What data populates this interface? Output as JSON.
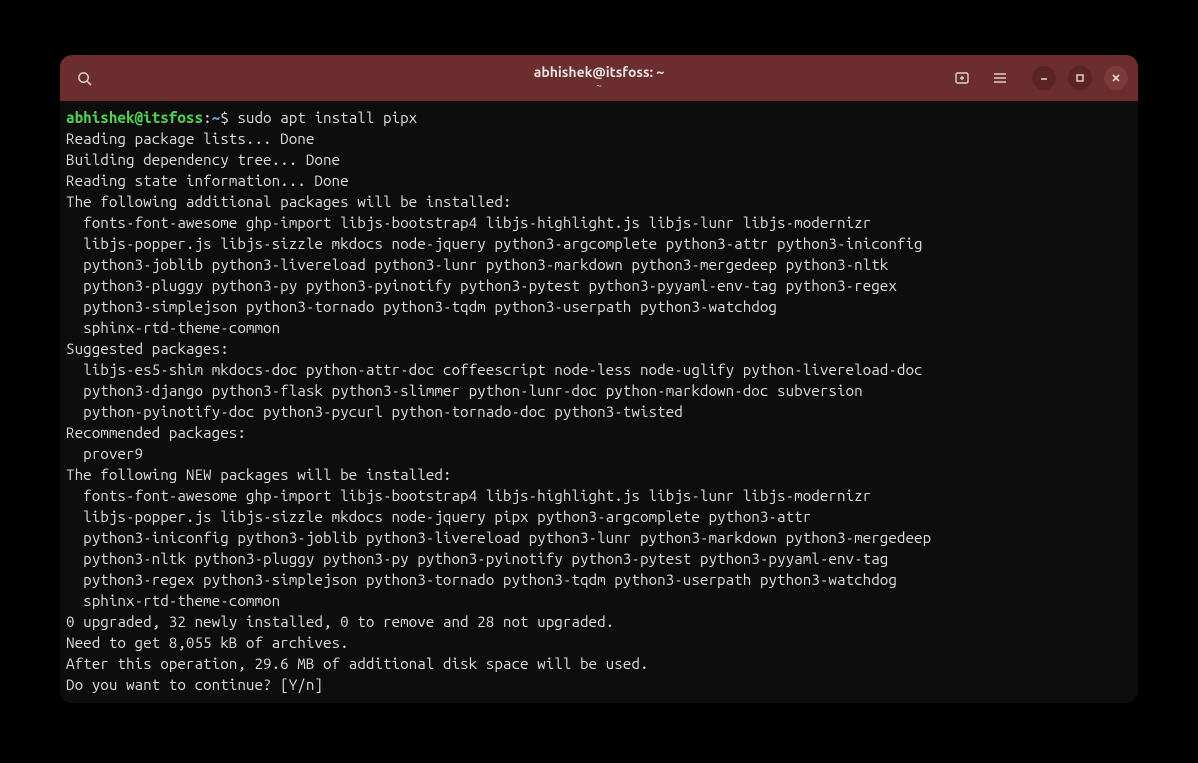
{
  "window": {
    "title": "abhishek@itsfoss: ~",
    "subtitle": "~"
  },
  "prompt": {
    "user_host": "abhishek@itsfoss",
    "sep1": ":",
    "path": "~",
    "sep2": "$ "
  },
  "command": "sudo apt install pipx",
  "output": {
    "l1": "Reading package lists... Done",
    "l2": "Building dependency tree... Done",
    "l3": "Reading state information... Done",
    "l4": "The following additional packages will be installed:",
    "l5": "  fonts-font-awesome ghp-import libjs-bootstrap4 libjs-highlight.js libjs-lunr libjs-modernizr",
    "l6": "  libjs-popper.js libjs-sizzle mkdocs node-jquery python3-argcomplete python3-attr python3-iniconfig",
    "l7": "  python3-joblib python3-livereload python3-lunr python3-markdown python3-mergedeep python3-nltk",
    "l8": "  python3-pluggy python3-py python3-pyinotify python3-pytest python3-pyyaml-env-tag python3-regex",
    "l9": "  python3-simplejson python3-tornado python3-tqdm python3-userpath python3-watchdog",
    "l10": "  sphinx-rtd-theme-common",
    "l11": "Suggested packages:",
    "l12": "  libjs-es5-shim mkdocs-doc python-attr-doc coffeescript node-less node-uglify python-livereload-doc",
    "l13": "  python3-django python3-flask python3-slimmer python-lunr-doc python-markdown-doc subversion",
    "l14": "  python-pyinotify-doc python3-pycurl python-tornado-doc python3-twisted",
    "l15": "Recommended packages:",
    "l16": "  prover9",
    "l17": "The following NEW packages will be installed:",
    "l18": "  fonts-font-awesome ghp-import libjs-bootstrap4 libjs-highlight.js libjs-lunr libjs-modernizr",
    "l19": "  libjs-popper.js libjs-sizzle mkdocs node-jquery pipx python3-argcomplete python3-attr",
    "l20": "  python3-iniconfig python3-joblib python3-livereload python3-lunr python3-markdown python3-mergedeep",
    "l21": "  python3-nltk python3-pluggy python3-py python3-pyinotify python3-pytest python3-pyyaml-env-tag",
    "l22": "  python3-regex python3-simplejson python3-tornado python3-tqdm python3-userpath python3-watchdog",
    "l23": "  sphinx-rtd-theme-common",
    "l24": "0 upgraded, 32 newly installed, 0 to remove and 28 not upgraded.",
    "l25": "Need to get 8,055 kB of archives.",
    "l26": "After this operation, 29.6 MB of additional disk space will be used.",
    "l27": "Do you want to continue? [Y/n] "
  }
}
